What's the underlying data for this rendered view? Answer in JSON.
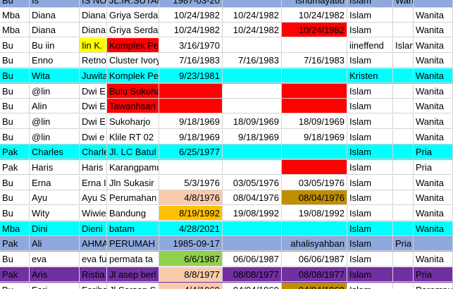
{
  "colors": {
    "cyan": "#00ffff",
    "blue_header": "#8ea9db",
    "purple": "#7030a0",
    "red": "#ff0000",
    "yellow": "#ffff00",
    "peach": "#f8cbad",
    "orange": "#ffc000",
    "olive": "#bf8f00",
    "green": "#92d050",
    "white": "#ffffff"
  },
  "rows": [
    {
      "bg": "#8ea9db",
      "cells": [
        {
          "t": "Bu"
        },
        {
          "t": "Is"
        },
        {
          "t": "IS NO"
        },
        {
          "t": "JL.IR.SUTAMI"
        },
        {
          "t": "1987-03-20"
        },
        {
          "t": ""
        },
        {
          "t": "Ishumayatio"
        },
        {
          "t": "Islam"
        },
        {
          "t": "Wanita"
        },
        {
          "t": ""
        }
      ]
    },
    {
      "bg": "#ffffff",
      "cells": [
        {
          "t": "Mba"
        },
        {
          "t": "Diana"
        },
        {
          "t": "Diana"
        },
        {
          "t": "Griya Serda"
        },
        {
          "t": "10/24/1982"
        },
        {
          "t": "10/24/1982"
        },
        {
          "t": "10/24/1982"
        },
        {
          "t": "Islam"
        },
        {
          "t": ""
        },
        {
          "t": "Wanita"
        }
      ]
    },
    {
      "bg": "#ffffff",
      "cells": [
        {
          "t": "Mba"
        },
        {
          "t": "Diana"
        },
        {
          "t": "Diana"
        },
        {
          "t": "Griya Serda"
        },
        {
          "t": "10/24/1982"
        },
        {
          "t": "10/24/1982"
        },
        {
          "t": "10/24/1982",
          "bg": "#ff0000"
        },
        {
          "t": "Islam"
        },
        {
          "t": ""
        },
        {
          "t": "Wanita"
        }
      ]
    },
    {
      "bg": "#ffffff",
      "cells": [
        {
          "t": "Bu"
        },
        {
          "t": "Bu iin"
        },
        {
          "t": "Iin K.",
          "bg": "#ffff00"
        },
        {
          "t": "Komplek Pe",
          "bg": "#ff0000"
        },
        {
          "t": "3/16/1970"
        },
        {
          "t": ""
        },
        {
          "t": ""
        },
        {
          "t": "iineffend"
        },
        {
          "t": "Islam"
        },
        {
          "t": "Wanita"
        }
      ]
    },
    {
      "bg": "#ffffff",
      "cells": [
        {
          "t": "Bu"
        },
        {
          "t": "Enno"
        },
        {
          "t": "Retno"
        },
        {
          "t": "Cluster Ivory"
        },
        {
          "t": "7/16/1983"
        },
        {
          "t": "7/16/1983"
        },
        {
          "t": "7/16/1983"
        },
        {
          "t": "Islam"
        },
        {
          "t": ""
        },
        {
          "t": "Wanita"
        }
      ]
    },
    {
      "bg": "#00ffff",
      "cells": [
        {
          "t": "Bu"
        },
        {
          "t": "Wita"
        },
        {
          "t": "Juwita"
        },
        {
          "t": "Komplek Pe"
        },
        {
          "t": "9/23/1981"
        },
        {
          "t": ""
        },
        {
          "t": ""
        },
        {
          "t": "Kristen"
        },
        {
          "t": ""
        },
        {
          "t": "Wanita"
        }
      ]
    },
    {
      "bg": "#ffffff",
      "cells": [
        {
          "t": "Bu"
        },
        {
          "t": "@lin"
        },
        {
          "t": "Dwi E"
        },
        {
          "t": "Bulu Sukoharjo Jateng",
          "bg": "#ff0000"
        },
        {
          "t": "",
          "bg": "#ff0000"
        },
        {
          "t": ""
        },
        {
          "t": "",
          "bg": "#ff0000"
        },
        {
          "t": "Islam"
        },
        {
          "t": ""
        },
        {
          "t": "Wanita"
        }
      ]
    },
    {
      "bg": "#ffffff",
      "cells": [
        {
          "t": "Bu"
        },
        {
          "t": "Alin"
        },
        {
          "t": "Dwi E"
        },
        {
          "t": "Tawanhsari Sukoharjo",
          "bg": "#ff0000"
        },
        {
          "t": "",
          "bg": "#ff0000"
        },
        {
          "t": ""
        },
        {
          "t": "",
          "bg": "#ff0000"
        },
        {
          "t": "Islam"
        },
        {
          "t": ""
        },
        {
          "t": "Wanita"
        }
      ]
    },
    {
      "bg": "#ffffff",
      "cells": [
        {
          "t": "Bu"
        },
        {
          "t": "@lin"
        },
        {
          "t": "Dwi E"
        },
        {
          "t": "Sukoharjo"
        },
        {
          "t": "9/18/1969"
        },
        {
          "t": "18/09/1969"
        },
        {
          "t": "18/09/1969"
        },
        {
          "t": "Islam"
        },
        {
          "t": ""
        },
        {
          "t": "Wanita"
        }
      ]
    },
    {
      "bg": "#ffffff",
      "cells": [
        {
          "t": "Bu"
        },
        {
          "t": "@lin"
        },
        {
          "t": "Dwi e"
        },
        {
          "t": "Klile RT 02"
        },
        {
          "t": "9/18/1969"
        },
        {
          "t": "9/18/1969"
        },
        {
          "t": "9/18/1969"
        },
        {
          "t": "Islam"
        },
        {
          "t": ""
        },
        {
          "t": "Wanita"
        }
      ]
    },
    {
      "bg": "#00ffff",
      "cells": [
        {
          "t": "Pak"
        },
        {
          "t": "Charles"
        },
        {
          "t": "Charle"
        },
        {
          "t": "Jl. LC Batul"
        },
        {
          "t": "6/25/1977"
        },
        {
          "t": ""
        },
        {
          "t": ""
        },
        {
          "t": "Islam"
        },
        {
          "t": ""
        },
        {
          "t": "Pria"
        }
      ]
    },
    {
      "bg": "#ffffff",
      "cells": [
        {
          "t": "Pak"
        },
        {
          "t": "Haris"
        },
        {
          "t": "Haris"
        },
        {
          "t": "Karangpamulang ,mandalajati Bandung"
        },
        {
          "t": ""
        },
        {
          "t": ""
        },
        {
          "t": "",
          "bg": "#ff0000"
        },
        {
          "t": "Islam"
        },
        {
          "t": ""
        },
        {
          "t": "Pria"
        }
      ]
    },
    {
      "bg": "#ffffff",
      "cells": [
        {
          "t": "Bu"
        },
        {
          "t": "Erna"
        },
        {
          "t": "Erna I"
        },
        {
          "t": "Jln Sukasir"
        },
        {
          "t": "5/3/1976"
        },
        {
          "t": "03/05/1976"
        },
        {
          "t": "03/05/1976"
        },
        {
          "t": "Islam"
        },
        {
          "t": ""
        },
        {
          "t": "Wanita"
        }
      ]
    },
    {
      "bg": "#ffffff",
      "cells": [
        {
          "t": "Bu"
        },
        {
          "t": "Ayu"
        },
        {
          "t": "Ayu S"
        },
        {
          "t": "Perumahan"
        },
        {
          "t": "4/8/1976",
          "bg": "#f8cbad"
        },
        {
          "t": "08/04/1976"
        },
        {
          "t": "08/04/1976",
          "bg": "#bf8f00"
        },
        {
          "t": "Islam"
        },
        {
          "t": ""
        },
        {
          "t": "Wanita"
        }
      ]
    },
    {
      "bg": "#ffffff",
      "cells": [
        {
          "t": "Bu"
        },
        {
          "t": "Wity"
        },
        {
          "t": "Wiwie"
        },
        {
          "t": "Bandung"
        },
        {
          "t": "8/19/1992",
          "bg": "#ffc000"
        },
        {
          "t": "19/08/1992"
        },
        {
          "t": "19/08/1992"
        },
        {
          "t": "Islam"
        },
        {
          "t": ""
        },
        {
          "t": "Wanita"
        }
      ]
    },
    {
      "bg": "#00ffff",
      "cells": [
        {
          "t": "Mba"
        },
        {
          "t": "Dini"
        },
        {
          "t": "Dieni"
        },
        {
          "t": "batam"
        },
        {
          "t": "4/28/2021"
        },
        {
          "t": ""
        },
        {
          "t": ""
        },
        {
          "t": "Islam"
        },
        {
          "t": ""
        },
        {
          "t": "Wanita"
        }
      ]
    },
    {
      "bg": "#8ea9db",
      "cells": [
        {
          "t": "Pak"
        },
        {
          "t": "Ali"
        },
        {
          "t": "AHMA"
        },
        {
          "t": "PERUMAH"
        },
        {
          "t": "1985-09-17"
        },
        {
          "t": ""
        },
        {
          "t": "ahalisyahban"
        },
        {
          "t": "Islam"
        },
        {
          "t": "Pria"
        },
        {
          "t": ""
        }
      ]
    },
    {
      "bg": "#ffffff",
      "cells": [
        {
          "t": "Bu"
        },
        {
          "t": "eva"
        },
        {
          "t": "eva fu"
        },
        {
          "t": "permata ta"
        },
        {
          "t": "6/6/1987",
          "bg": "#92d050"
        },
        {
          "t": "06/06/1987"
        },
        {
          "t": "06/06/1987"
        },
        {
          "t": "Islam"
        },
        {
          "t": ""
        },
        {
          "t": "Wanita"
        }
      ]
    },
    {
      "bg": "#7030a0",
      "cells": [
        {
          "t": "Pak"
        },
        {
          "t": "Aris"
        },
        {
          "t": "Ristia"
        },
        {
          "t": "Jl asep berl"
        },
        {
          "t": "8/8/1977",
          "bg": "#f8cbad"
        },
        {
          "t": "08/08/1977"
        },
        {
          "t": "08/08/1977"
        },
        {
          "t": "Islam"
        },
        {
          "t": ""
        },
        {
          "t": "Pria"
        }
      ]
    },
    {
      "bg": "#ffffff",
      "cells": [
        {
          "t": "Bu"
        },
        {
          "t": "Fari"
        },
        {
          "t": "Fariha"
        },
        {
          "t": "Jl Sersan S"
        },
        {
          "t": "4/4/1969",
          "bg": "#f8cbad"
        },
        {
          "t": "04/04/1969"
        },
        {
          "t": "04/04/1969",
          "bg": "#bf8f00"
        },
        {
          "t": "Islam"
        },
        {
          "t": ""
        },
        {
          "t": "Perempu"
        }
      ]
    }
  ]
}
